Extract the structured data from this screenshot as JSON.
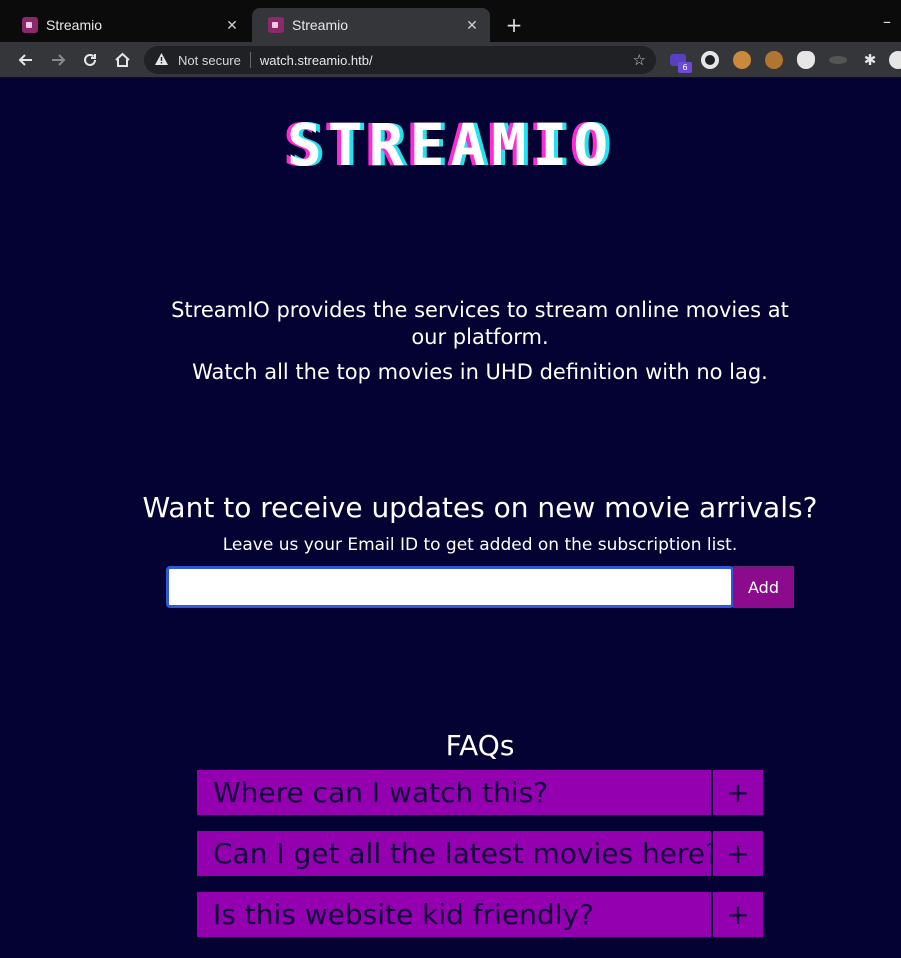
{
  "browser": {
    "tabs": [
      {
        "label": "Streamio",
        "active": false
      },
      {
        "label": "Streamio",
        "active": true
      }
    ],
    "new_tab_icon": "plus-icon",
    "security_label": "Not secure",
    "url": "watch.streamio.htb/",
    "extension_badge": "6"
  },
  "page": {
    "logo": "STREAMIO",
    "intro_line1": "StreamIO provides the services to stream online movies at our platform.",
    "intro_line2": "Watch all the top movies in UHD definition with no lag.",
    "subscribe": {
      "heading": "Want to receive updates on new movie arrivals?",
      "subtext": "Leave us your Email ID to get added on the subscription list.",
      "email_value": "",
      "button_label": "Add"
    },
    "faq": {
      "heading": "FAQs",
      "items": [
        {
          "question": "Where can I watch this?",
          "toggle": "+"
        },
        {
          "question": "Can I get all the latest movies here?",
          "toggle": "+"
        },
        {
          "question": "Is this website kid friendly?",
          "toggle": "+"
        }
      ]
    }
  },
  "colors": {
    "page_background": "#030233",
    "faq_accent": "#9400b0",
    "button_accent": "#8c0a8c",
    "logo_shadow_pink": "#ff2ad4",
    "logo_shadow_cyan": "#1ee3f0"
  }
}
